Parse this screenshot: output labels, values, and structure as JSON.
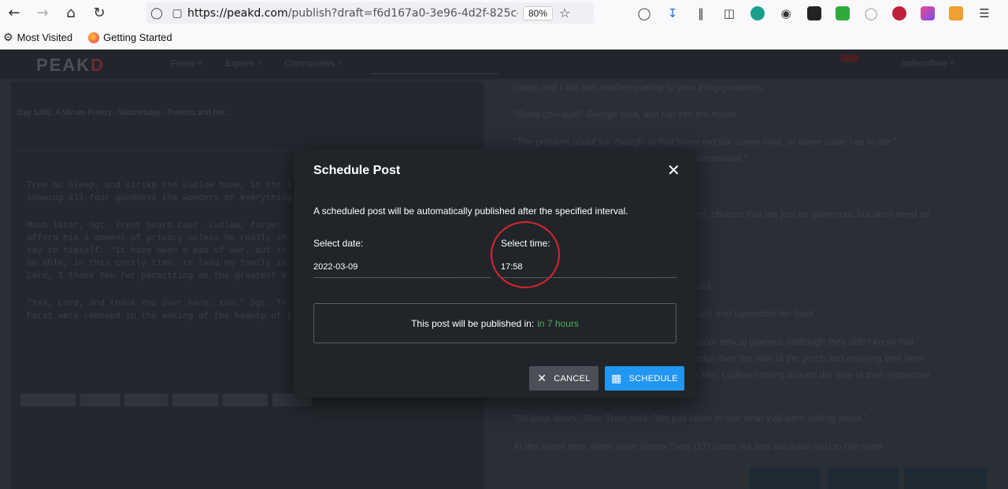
{
  "browser": {
    "url_prefix": "https://peakd.com",
    "url_rest": "/publish?draft=f6d167a0-3e96-4d2f-825c-17028a",
    "zoom": "80%",
    "bookmarks": [
      "Most Visited",
      "Getting Started"
    ]
  },
  "site": {
    "logo": "PEAK",
    "logo_accent": "D",
    "nav": [
      "Feeds ˅",
      "Explore ˅",
      "Communities ˅"
    ],
    "user": "ladiesofhive ˅"
  },
  "background": {
    "editor_title": "Day 1406: A Minute Frenzy - Wednesday - Frances and her...",
    "editor_lines": [
      "Tree No Sleep, and strike the Ludlow home, in the l...",
      "showing all four goodness the wonders of everything...",
      "Much later, Sgt. Trent heard Capt. Ludlow, forget...",
      "afford him a moment of privacy unless he really sh...",
      "say to himself: \"It have been a man of war, but in...",
      "be able, in this costly time, to lead my family in...",
      "Lord, I thank You for permitting me the greatest m...",
      "\"Yes, Lord, and thank You over here, too,\" Sgt. Tr...",
      "Forst were removed in the making of the beauty of t..."
    ],
    "right_lines": [
      "today, and I will add another overlay to your thing goodness.",
      "\"Gotta go—bye!\" George said, and ran into the house.",
      "\"The problem about fur, though, is that some red fox, some mink, or some sable has to die.\"",
      "alternatives.\"",
      "ers, choices that are just as glamorous but don't need us",
      "said",
      "said, and squeezed her back.",
      "about ethical glamour (although they didn't know that",
      "ledge over the side of the porch and enjoying their time",
      "d Mrs. Ludlow coming around the side of their respective",
      "\"Sit back down,\" Mrs. Trent said. \"We just came to see what y'all were talking about.\"",
      "At this same time, elder sister Vanna Trent (17) came out and sat down next to her sister"
    ]
  },
  "modal": {
    "title": "Schedule Post",
    "description": "A scheduled post will be automatically published after the specified interval.",
    "date_label": "Select date:",
    "date_value": "2022-03-09",
    "time_label": "Select time:",
    "time_value": "17:58",
    "publish_info_prefix": "This post will be published in:",
    "publish_info_value": "in 7 hours",
    "cancel_label": "CANCEL",
    "schedule_label": "SCHEDULE"
  },
  "colors": {
    "primary": "#2196f3",
    "highlight_green": "#4caf50",
    "annotation_red": "#d9262c",
    "modal_bg": "#212529"
  }
}
